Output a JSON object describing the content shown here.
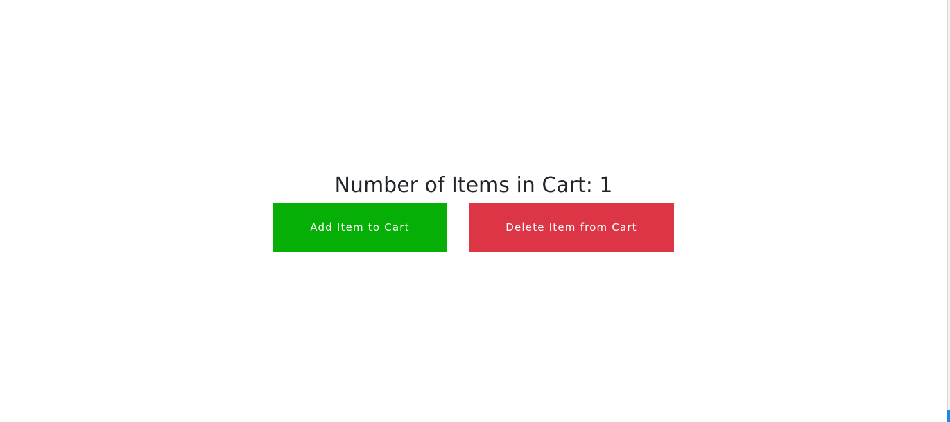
{
  "cart": {
    "heading": "Number of Items in Cart: 1",
    "count": 1
  },
  "buttons": {
    "add_label": "Add Item to Cart",
    "delete_label": "Delete Item from Cart"
  },
  "colors": {
    "add_button": "#05af05",
    "delete_button": "#dc3545",
    "heading_text": "#212529",
    "background": "#ffffff"
  }
}
